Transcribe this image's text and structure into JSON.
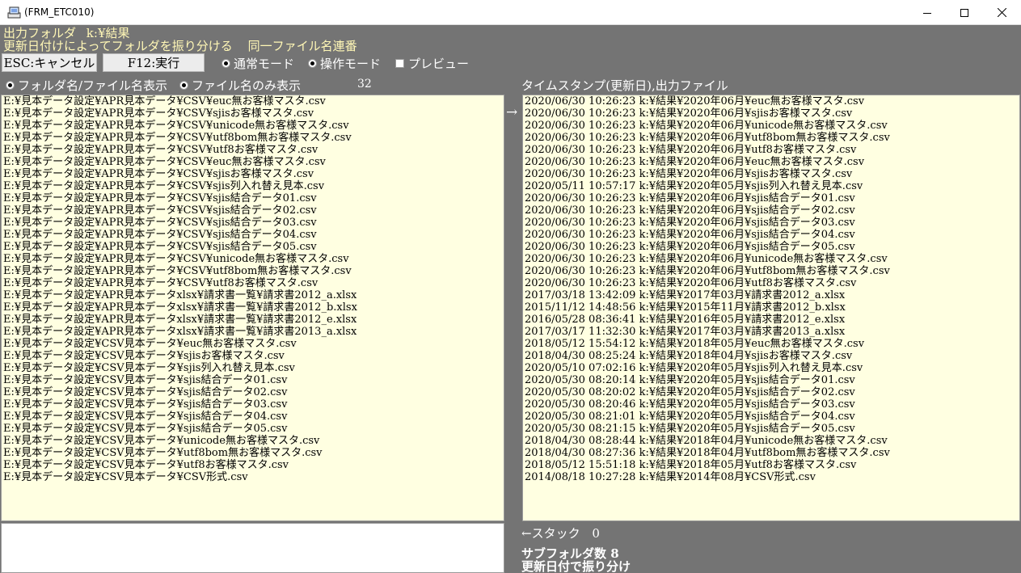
{
  "window": {
    "title": "(FRM_ETC010)",
    "minimize_label": "",
    "controls": [
      "minimize-icon",
      "maximize-icon",
      "close-icon"
    ]
  },
  "header": {
    "output_folder_label": "出力フォルダ",
    "output_folder_value": "k:¥結果",
    "sort_description": "更新日付けによってフォルダを振り分ける",
    "same_name_label": "同一ファイル名連番"
  },
  "toolbar": {
    "esc_label": "ESC:キャンセル",
    "f12_label": "F12:実行",
    "mode_normal": "通常モード",
    "mode_operation": "操作モード",
    "preview_label": "プレビュー",
    "selected_mode": "通常モード",
    "preview_checked": false
  },
  "view_options": {
    "show_folder_file": "フォルダ名/ファイル名表示",
    "show_file_only": "ファイル名のみ表示",
    "selected": "フォルダ名/ファイル名表示",
    "count": "32"
  },
  "right_header": "タイムスタンプ(更新日),出力ファイル",
  "arrow_right": "→",
  "stack_label": "←スタック",
  "stack_count": "0",
  "subfolder_label": "サブフォルダ数 8",
  "sort_by_date_label": "更新日付で振り分け",
  "colors": {
    "background": "#747474",
    "list_background": "#ffffe1",
    "header_text": "#fff7b6"
  },
  "source_files": [
    "E:¥見本データ設定¥APR見本データ¥CSV¥euc無お客様マスタ.csv",
    "E:¥見本データ設定¥APR見本データ¥CSV¥sjisお客様マスタ.csv",
    "E:¥見本データ設定¥APR見本データ¥CSV¥unicode無お客様マスタ.csv",
    "E:¥見本データ設定¥APR見本データ¥CSV¥utf8bom無お客様マスタ.csv",
    "E:¥見本データ設定¥APR見本データ¥CSV¥utf8お客様マスタ.csv",
    "E:¥見本データ設定¥APR見本データ¥CSV¥euc無お客様マスタ.csv",
    "E:¥見本データ設定¥APR見本データ¥CSV¥sjisお客様マスタ.csv",
    "E:¥見本データ設定¥APR見本データ¥CSV¥sjis列入れ替え見本.csv",
    "E:¥見本データ設定¥APR見本データ¥CSV¥sjis結合データ01.csv",
    "E:¥見本データ設定¥APR見本データ¥CSV¥sjis結合データ02.csv",
    "E:¥見本データ設定¥APR見本データ¥CSV¥sjis結合データ03.csv",
    "E:¥見本データ設定¥APR見本データ¥CSV¥sjis結合データ04.csv",
    "E:¥見本データ設定¥APR見本データ¥CSV¥sjis結合データ05.csv",
    "E:¥見本データ設定¥APR見本データ¥CSV¥unicode無お客様マスタ.csv",
    "E:¥見本データ設定¥APR見本データ¥CSV¥utf8bom無お客様マスタ.csv",
    "E:¥見本データ設定¥APR見本データ¥CSV¥utf8お客様マスタ.csv",
    "E:¥見本データ設定¥APR見本データxlsx¥請求書一覧¥請求書2012_a.xlsx",
    "E:¥見本データ設定¥APR見本データxlsx¥請求書一覧¥請求書2012_b.xlsx",
    "E:¥見本データ設定¥APR見本データxlsx¥請求書一覧¥請求書2012_e.xlsx",
    "E:¥見本データ設定¥APR見本データxlsx¥請求書一覧¥請求書2013_a.xlsx",
    "E:¥見本データ設定¥CSV見本データ¥euc無お客様マスタ.csv",
    "E:¥見本データ設定¥CSV見本データ¥sjisお客様マスタ.csv",
    "E:¥見本データ設定¥CSV見本データ¥sjis列入れ替え見本.csv",
    "E:¥見本データ設定¥CSV見本データ¥sjis結合データ01.csv",
    "E:¥見本データ設定¥CSV見本データ¥sjis結合データ02.csv",
    "E:¥見本データ設定¥CSV見本データ¥sjis結合データ03.csv",
    "E:¥見本データ設定¥CSV見本データ¥sjis結合データ04.csv",
    "E:¥見本データ設定¥CSV見本データ¥sjis結合データ05.csv",
    "E:¥見本データ設定¥CSV見本データ¥unicode無お客様マスタ.csv",
    "E:¥見本データ設定¥CSV見本データ¥utf8bom無お客様マスタ.csv",
    "E:¥見本データ設定¥CSV見本データ¥utf8お客様マスタ.csv",
    "E:¥見本データ設定¥CSV見本データ¥CSV形式.csv"
  ],
  "output_files": [
    "2020/06/30 10:26:23  k:¥結果¥2020年06月¥euc無お客様マスタ.csv",
    "2020/06/30 10:26:23  k:¥結果¥2020年06月¥sjisお客様マスタ.csv",
    "2020/06/30 10:26:23  k:¥結果¥2020年06月¥unicode無お客様マスタ.csv",
    "2020/06/30 10:26:23  k:¥結果¥2020年06月¥utf8bom無お客様マスタ.csv",
    "2020/06/30 10:26:23  k:¥結果¥2020年06月¥utf8お客様マスタ.csv",
    "2020/06/30 10:26:23  k:¥結果¥2020年06月¥euc無お客様マスタ.csv",
    "2020/06/30 10:26:23  k:¥結果¥2020年06月¥sjisお客様マスタ.csv",
    "2020/05/11 10:57:17  k:¥結果¥2020年05月¥sjis列入れ替え見本.csv",
    "2020/06/30 10:26:23  k:¥結果¥2020年06月¥sjis結合データ01.csv",
    "2020/06/30 10:26:23  k:¥結果¥2020年06月¥sjis結合データ02.csv",
    "2020/06/30 10:26:23  k:¥結果¥2020年06月¥sjis結合データ03.csv",
    "2020/06/30 10:26:23  k:¥結果¥2020年06月¥sjis結合データ04.csv",
    "2020/06/30 10:26:23  k:¥結果¥2020年06月¥sjis結合データ05.csv",
    "2020/06/30 10:26:23  k:¥結果¥2020年06月¥unicode無お客様マスタ.csv",
    "2020/06/30 10:26:23  k:¥結果¥2020年06月¥utf8bom無お客様マスタ.csv",
    "2020/06/30 10:26:23  k:¥結果¥2020年06月¥utf8お客様マスタ.csv",
    "2017/03/18 13:42:09  k:¥結果¥2017年03月¥請求書2012_a.xlsx",
    "2015/11/12 14:48:56  k:¥結果¥2015年11月¥請求書2012_b.xlsx",
    "2016/05/28 08:36:41  k:¥結果¥2016年05月¥請求書2012_e.xlsx",
    "2017/03/17 11:32:30  k:¥結果¥2017年03月¥請求書2013_a.xlsx",
    "2018/05/12 15:54:12  k:¥結果¥2018年05月¥euc無お客様マスタ.csv",
    "2018/04/30 08:25:24  k:¥結果¥2018年04月¥sjisお客様マスタ.csv",
    "2020/05/10 07:02:16  k:¥結果¥2020年05月¥sjis列入れ替え見本.csv",
    "2020/05/30 08:20:14  k:¥結果¥2020年05月¥sjis結合データ01.csv",
    "2020/05/30 08:20:02  k:¥結果¥2020年05月¥sjis結合データ02.csv",
    "2020/05/30 08:20:46  k:¥結果¥2020年05月¥sjis結合データ03.csv",
    "2020/05/30 08:21:01  k:¥結果¥2020年05月¥sjis結合データ04.csv",
    "2020/05/30 08:21:15  k:¥結果¥2020年05月¥sjis結合データ05.csv",
    "2018/04/30 08:28:44  k:¥結果¥2018年04月¥unicode無お客様マスタ.csv",
    "2018/04/30 08:27:36  k:¥結果¥2018年04月¥utf8bom無お客様マスタ.csv",
    "2018/05/12 15:51:18  k:¥結果¥2018年05月¥utf8お客様マスタ.csv",
    "2014/08/18 10:27:28  k:¥結果¥2014年08月¥CSV形式.csv"
  ]
}
